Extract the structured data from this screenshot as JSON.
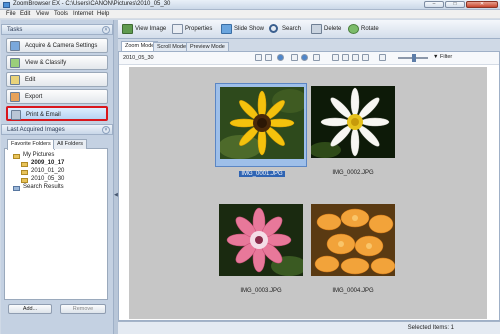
{
  "window": {
    "title": "ZoomBrowser EX - C:\\Users\\CANON\\Pictures\\2010_05_30",
    "minimize": "–",
    "maximize": "□",
    "close": "✕"
  },
  "menu": [
    "File",
    "Edit",
    "View",
    "Tools",
    "Internet",
    "Help"
  ],
  "tasks": {
    "header": "Tasks",
    "collapse_glyph": "˄",
    "items": [
      {
        "label": "Acquire & Camera Settings",
        "icon": "camera-icon"
      },
      {
        "label": "View & Classify",
        "icon": "view-classify-icon"
      },
      {
        "label": "Edit",
        "icon": "edit-icon"
      },
      {
        "label": "Export",
        "icon": "export-icon"
      },
      {
        "label": "Print & Email",
        "icon": "print-email-icon"
      }
    ]
  },
  "last_acquired": {
    "header": "Last Acquired Images",
    "collapse_glyph": "˅"
  },
  "folders": {
    "tabs": [
      "Favorite Folders",
      "All Folders"
    ],
    "tree": [
      "My Pictures",
      "2009_10_17",
      "2010_01_20",
      "2010_05_30",
      "Search Results"
    ],
    "add_button": "Add...",
    "remove_button": "Remove"
  },
  "toolbar": {
    "buttons": [
      "View Image",
      "Properties",
      "Slide Show",
      "Search",
      "Delete",
      "Rotate"
    ]
  },
  "modes": [
    "Zoom Mode",
    "Scroll Mode",
    "Preview Mode"
  ],
  "content": {
    "folder_date": "2010_05_30",
    "filter_label": "Filter",
    "zoom_level": 0.55,
    "thumbnails": [
      {
        "name": "IMG_0001.JPG",
        "selected": true
      },
      {
        "name": "IMG_0002.JPG",
        "selected": false
      },
      {
        "name": "IMG_0003.JPG",
        "selected": false
      },
      {
        "name": "IMG_0004.JPG",
        "selected": false
      }
    ]
  },
  "status": {
    "text": "Selected Items: 1"
  },
  "colors": {
    "highlight_border": "#d9161c",
    "selection": "#2f64b3",
    "canvas": "#c6c6c6"
  }
}
